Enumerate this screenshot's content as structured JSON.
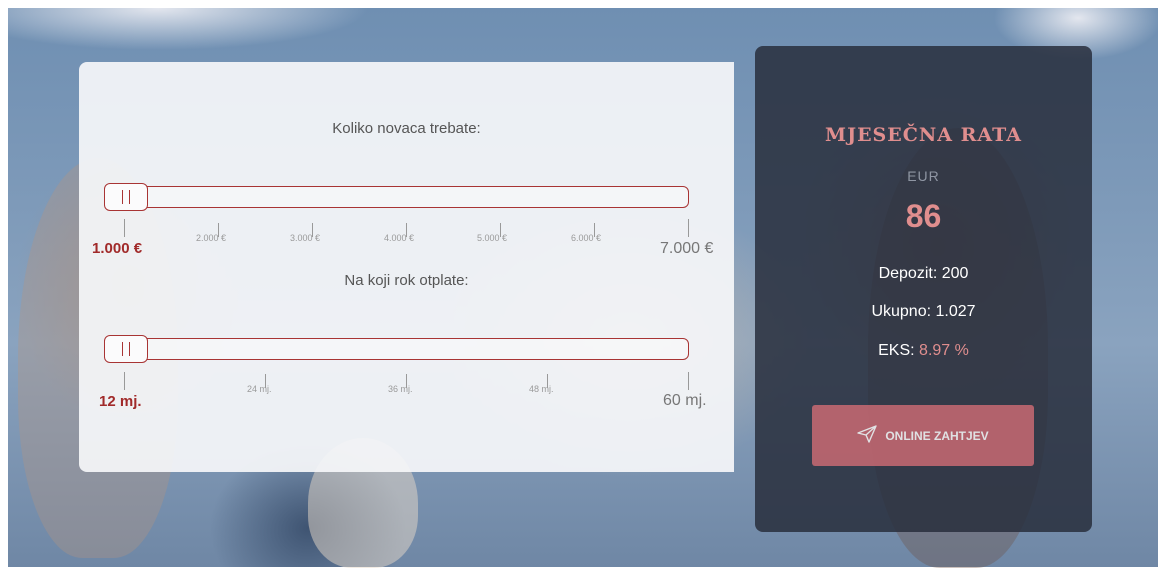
{
  "loan_slider": {
    "title": "Koliko novaca trebate:",
    "value": 1000,
    "min": 1000,
    "max": 7000,
    "ticks": [
      "1.000 €",
      "2.000 €",
      "3.000 €",
      "4.000 €",
      "5.000 €",
      "6.000 €",
      "7.000 €"
    ]
  },
  "term_slider": {
    "title": "Na koji rok otplate:",
    "value": 12,
    "min": 12,
    "max": 60,
    "ticks": [
      "12 mj.",
      "24 mj.",
      "36 mj.",
      "48 mj.",
      "60 mj."
    ]
  },
  "result": {
    "title": "MJESEČNA RATA",
    "currency": "EUR",
    "monthly_value": "86",
    "deposit_label": "Depozit:",
    "deposit_value": "200",
    "total_label": "Ukupno:",
    "total_value": "1.027",
    "eks_label": "EKS:",
    "eks_value": "8.97 %",
    "button_label": "ONLINE ZAHTJEV",
    "button_icon": "paper-plane-icon"
  },
  "colors": {
    "accent": "#a83434",
    "result_accent": "#e08e8e",
    "button": "#c96a73",
    "result_bg": "#282e3c"
  }
}
